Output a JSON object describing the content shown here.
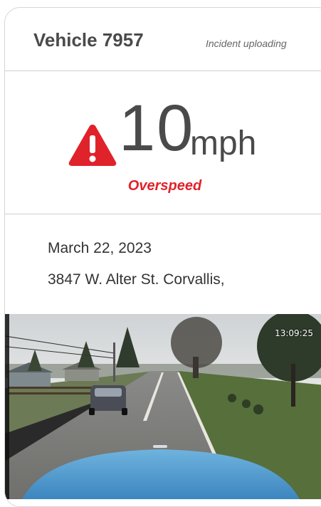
{
  "header": {
    "vehicle_title": "Vehicle 7957",
    "status": "Incident uploading"
  },
  "speed": {
    "value": "10",
    "unit": "mph",
    "event_label": "Overspeed",
    "warning_icon": "warning-triangle-icon"
  },
  "details": {
    "date": "March 22, 2023",
    "address": "3847 W. Alter St. Corvallis,"
  },
  "video": {
    "timestamp": "13:09:25"
  },
  "colors": {
    "alert_red": "#e0222b",
    "text_dark": "#4a4a4a"
  }
}
